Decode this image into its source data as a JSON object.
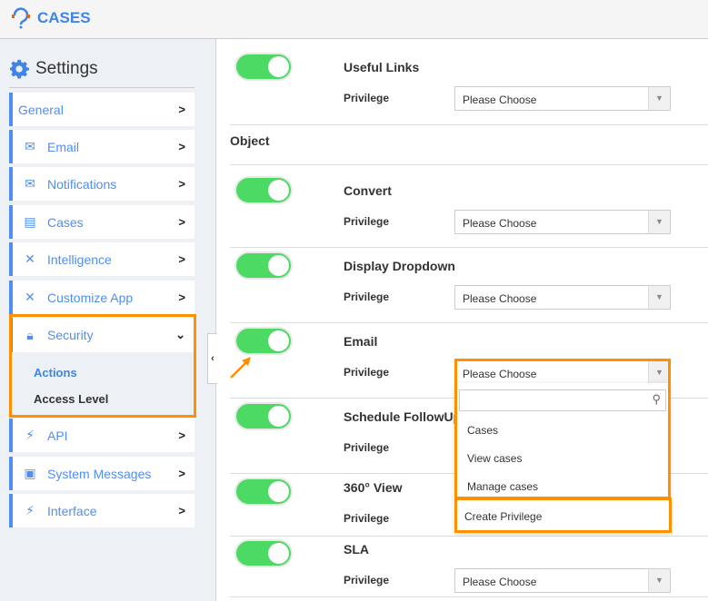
{
  "app": {
    "name": "CASES"
  },
  "sidebar": {
    "title": "Settings",
    "items": [
      {
        "label": "General",
        "icon": "none"
      },
      {
        "label": "Email",
        "icon": "envelope-icon"
      },
      {
        "label": "Notifications",
        "icon": "envelope-icon"
      },
      {
        "label": "Cases",
        "icon": "list-icon"
      },
      {
        "label": "Intelligence",
        "icon": "tools-icon"
      },
      {
        "label": "Customize App",
        "icon": "tools-icon"
      },
      {
        "label": "Security",
        "icon": "lock-icon",
        "expanded": true,
        "children": [
          {
            "label": "Actions",
            "active": true
          },
          {
            "label": "Access Level"
          }
        ]
      },
      {
        "label": "API",
        "icon": "plug-icon"
      },
      {
        "label": "System Messages",
        "icon": "message-icon"
      },
      {
        "label": "Interface",
        "icon": "plug-icon"
      }
    ]
  },
  "main": {
    "privilege_label": "Privilege",
    "placeholder": "Please Choose",
    "section": "Object",
    "rows": [
      {
        "title": "Useful Links",
        "enabled": true
      },
      {
        "title": "Convert",
        "enabled": true
      },
      {
        "title": "Display Dropdown",
        "enabled": true
      },
      {
        "title": "Email",
        "enabled": true
      },
      {
        "title": "Schedule FollowUp",
        "enabled": true
      },
      {
        "title": "360° View",
        "enabled": true
      },
      {
        "title": "SLA",
        "enabled": true
      }
    ]
  },
  "dropdown": {
    "search_value": "",
    "options": [
      "Cases",
      "View cases",
      "Manage cases"
    ],
    "create": "Create Privilege"
  },
  "colors": {
    "accent": "#4f8ef2",
    "toggle_on": "#4cd964",
    "highlight": "#ff9100"
  }
}
